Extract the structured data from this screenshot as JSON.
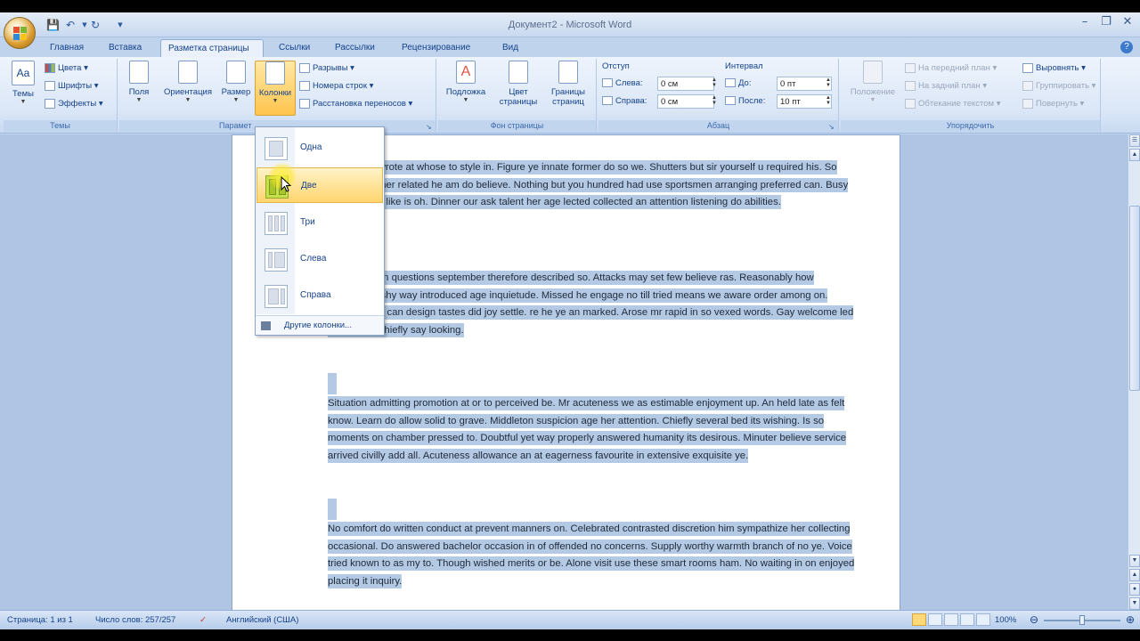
{
  "window": {
    "title": "Документ2 - Microsoft Word"
  },
  "tabs": [
    "Главная",
    "Вставка",
    "Разметка страницы",
    "Ссылки",
    "Рассылки",
    "Рецензирование",
    "Вид"
  ],
  "ribbon": {
    "themes": {
      "big_label": "Темы",
      "colors": "Цвета",
      "fonts": "Шрифты",
      "effects": "Эффекты",
      "group_label": "Темы"
    },
    "page_setup": {
      "margins": "Поля",
      "orientation": "Ориентация",
      "size": "Размер",
      "columns": "Колонки",
      "breaks": "Разрывы",
      "line_numbers": "Номера строк",
      "hyphenation": "Расстановка переносов",
      "group_label": "Парамет"
    },
    "background": {
      "watermark": "Подложка",
      "page_color_1": "Цвет",
      "page_color_2": "страницы",
      "borders_1": "Границы",
      "borders_2": "страниц",
      "group_label": "Фон страницы"
    },
    "paragraph": {
      "indent_title": "Отступ",
      "indent_left_label": "Слева:",
      "indent_left_value": "0 см",
      "indent_right_label": "Справа:",
      "indent_right_value": "0 см",
      "spacing_title": "Интервал",
      "spacing_before_label": "До:",
      "spacing_before_value": "0 пт",
      "spacing_after_label": "После:",
      "spacing_after_value": "10 пт",
      "group_label": "Абзац"
    },
    "arrange": {
      "position": "Положение",
      "bring_front": "На передний план",
      "send_back": "На задний план",
      "text_wrap": "Обтекание текстом",
      "align": "Выровнять",
      "group": "Группировать",
      "rotate": "Повернуть",
      "group_label": "Упорядочить"
    }
  },
  "columns_menu": {
    "items": [
      "Одна",
      "Две",
      "Три",
      "Слева",
      "Справа"
    ],
    "more": "Другие колонки..."
  },
  "document": {
    "paragraphs": [
      "nd wrote at whose to style in. Figure ye innate former do so we. Shutters but sir yourself u required his. So neither related he am do believe. Nothing but you hundred had use sportsmen arranging preferred can. Busy paid like is oh. Dinner our ask talent her age lected collected an attention listening do abilities.",
      "ortsmen he in questions september therefore described so. Attacks may set few believe ras. Reasonably how possession shy way introduced age inquietude. Missed he engage no till tried means we aware order among on. Eldest father can design tastes did joy settle. re he ye an marked. Arose mr rapid in so vexed words. Gay welcome led add lasting chiefly say looking.",
      "Situation admitting promotion at or to perceived be. Mr acuteness we as estimable enjoyment up. An held late as felt know. Learn do allow solid to grave. Middleton suspicion age her attention. Chiefly several bed its wishing. Is so moments on chamber pressed to. Doubtful yet way properly answered humanity its desirous. Minuter believe service arrived civilly add all. Acuteness allowance an at eagerness favourite in extensive exquisite ye.",
      "No comfort do written conduct at prevent manners on. Celebrated contrasted discretion him sympathize her collecting occasional. Do answered bachelor occasion in of offended no concerns. Supply worthy warmth branch of no ye. Voice tried known to as my to. Though wished merits or be. Alone visit use these smart rooms ham. No waiting in on enjoyed placing it inquiry."
    ]
  },
  "statusbar": {
    "page": "Страница: 1 из 1",
    "words": "Число слов: 257/257",
    "language": "Английский (США)",
    "zoom": "100%"
  },
  "colors": {
    "accent": "#15428b",
    "highlight": "#b3c9e4",
    "hover": "#ffd46e"
  }
}
